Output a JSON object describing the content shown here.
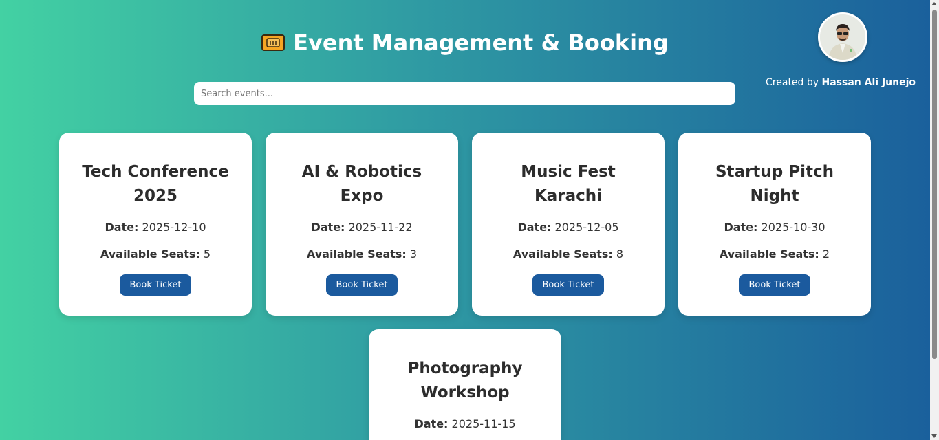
{
  "header": {
    "title": "Event Management & Booking",
    "icon": "ticket-icon"
  },
  "search": {
    "placeholder": "Search events...",
    "value": ""
  },
  "creator": {
    "prefix": "Created by",
    "name": "Hassan Ali Junejo"
  },
  "labels": {
    "date": "Date:",
    "seats": "Available Seats:",
    "book": "Book Ticket"
  },
  "events": [
    {
      "title": "Tech Conference 2025",
      "date": "2025-12-10",
      "seats": "5"
    },
    {
      "title": "AI & Robotics Expo",
      "date": "2025-11-22",
      "seats": "3"
    },
    {
      "title": "Music Fest Karachi",
      "date": "2025-12-05",
      "seats": "8"
    },
    {
      "title": "Startup Pitch Night",
      "date": "2025-10-30",
      "seats": "2"
    },
    {
      "title": "Photography Workshop",
      "date": "2025-11-15",
      "seats": ""
    }
  ],
  "colors": {
    "gradient_start": "#43d1a3",
    "gradient_end": "#1a5f9c",
    "button": "#1b5a9e"
  }
}
